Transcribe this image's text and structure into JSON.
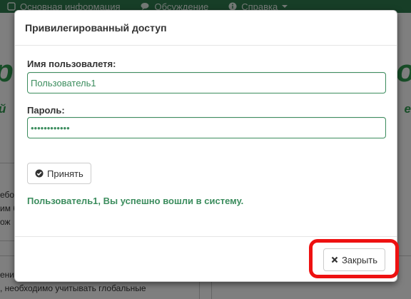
{
  "background": {
    "nav_items": [
      {
        "label": "Основная информация",
        "icon": "info-icon"
      },
      {
        "label": "Обсуждение",
        "icon": "comments-icon"
      },
      {
        "label": "Справка",
        "icon": "info-circle-icon",
        "has_dropdown": true
      }
    ],
    "big_left": "р",
    "big_right": "то",
    "sub_left": "й",
    "sub_right": "е",
    "text1_lines": [
      "ебол",
      "им б",
      "ож"
    ],
    "text2_lines": [
      "ения",
      ", необходимо учитывать глобальные",
      "    "
    ]
  },
  "modal": {
    "title": "Привилегированный доступ",
    "username_label": "Имя пользовалетя:",
    "username_value": "Пользователь1",
    "password_label": "Пароль:",
    "password_value": "••••••••••••",
    "accept_label": "Принять",
    "status_message": "Пользователь1, Вы успешно вошли в систему.",
    "close_label": "Закрыть"
  },
  "colors": {
    "brand_green": "#3c8d5e",
    "nav_green": "#2e7d4f",
    "highlight_red": "#ee1111"
  }
}
